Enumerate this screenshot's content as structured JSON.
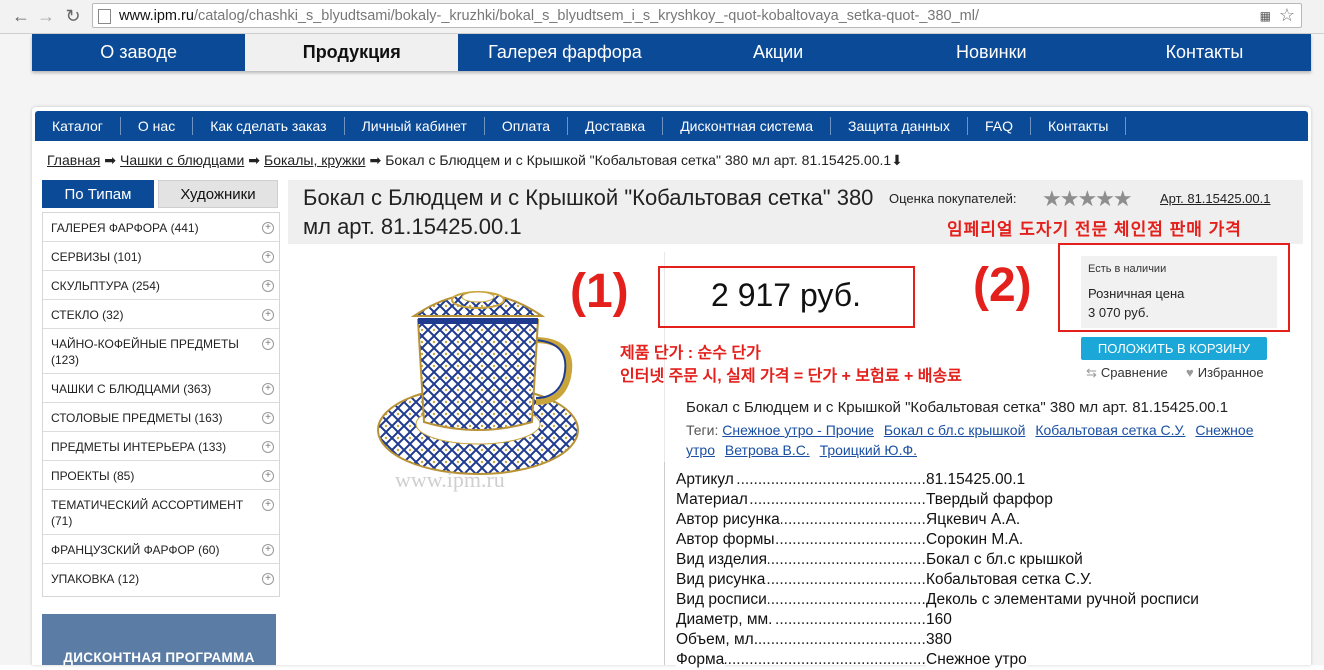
{
  "browser": {
    "url_host": "www.ipm.ru",
    "url_path": "/catalog/chashki_s_blyudtsami/bokaly-_kruzhki/bokal_s_blyudtsem_i_s_kryshkoy_-quot-kobaltovaya_setka-quot-_380_ml/"
  },
  "topnav": [
    "О заводе",
    "Продукция",
    "Галерея фарфора",
    "Акции",
    "Новинки",
    "Контакты"
  ],
  "subnav": [
    "Каталог",
    "О нас",
    "Как сделать заказ",
    "Личный кабинет",
    "Оплата",
    "Доставка",
    "Дисконтная система",
    "Защита данных",
    "FAQ",
    "Контакты"
  ],
  "breadcrumb": {
    "home": "Главная",
    "cat1": "Чашки с блюдцами",
    "cat2": "Бокалы, кружки",
    "current": "Бокал с Блюдцем и с Крышкой \"Кобальтовая сетка\" 380 мл арт. 81.15425.00.1⬇",
    "sep": "➡"
  },
  "sidebar": {
    "tab_types": "По Типам",
    "tab_artists": "Художники",
    "categories": [
      "ГАЛЕРЕЯ ФАРФОРА (441)",
      "СЕРВИЗЫ (101)",
      "СКУЛЬПТУРА (254)",
      "СТЕКЛО (32)",
      "ЧАЙНО-КОФЕЙНЫЕ ПРЕДМЕТЫ (123)",
      "ЧАШКИ С БЛЮДЦАМИ (363)",
      "СТОЛОВЫЕ ПРЕДМЕТЫ (163)",
      "ПРЕДМЕТЫ ИНТЕРЬЕРА (133)",
      "ПРОЕКТЫ (85)",
      "ТЕМАТИЧЕСКИЙ АССОРТИМЕНТ (71)",
      "ФРАНЦУЗСКИЙ ФАРФОР (60)",
      "УПАКОВКА (12)"
    ],
    "promo": "ДИСКОНТНАЯ ПРОГРАММА"
  },
  "product": {
    "title": "Бокал с Блюдцем и с Крышкой \"Кобальтовая сетка\" 380 мл арт. 81.15425.00.1",
    "rating_label": "Оценка покупателей:",
    "stars": "★★★★★",
    "article_link": "Арт. 81.15425.00.1",
    "watermark": "www.ipm.ru",
    "price": "2 917 руб.",
    "in_stock": "Есть в наличии",
    "retail_label": "Розничная цена",
    "retail_price": "3 070 руб.",
    "cart_button": "ПОЛОЖИТЬ В КОРЗИНУ",
    "compare": "Сравнение",
    "favorite": "Избранное",
    "name_line": "Бокал с Блюдцем и с Крышкой \"Кобальтовая сетка\" 380 мл арт. 81.15425.00.1",
    "tags_label": "Теги:",
    "tags": [
      "Снежное утро - Прочие",
      "Бокал с бл.с крышкой",
      "Кобальтовая сетка С.У.",
      "Снежное утро",
      "Ветрова В.С.",
      "Троицкий Ю.Ф."
    ],
    "specs": [
      {
        "k": "Артикул",
        "v": "81.15425.00.1"
      },
      {
        "k": "Материал",
        "v": "Твердый фарфор"
      },
      {
        "k": "Автор рисунка",
        "v": "Яцкевич А.А."
      },
      {
        "k": "Автор формы",
        "v": "Сорокин М.А."
      },
      {
        "k": "Вид изделия",
        "v": "Бокал с бл.с крышкой"
      },
      {
        "k": "Вид рисунка",
        "v": "Кобальтовая сетка С.У."
      },
      {
        "k": "Вид росписи",
        "v": "Деколь с элементами ручной росписи"
      },
      {
        "k": "Диаметр, мм.",
        "v": "160"
      },
      {
        "k": "Объем, мл.",
        "v": "380"
      },
      {
        "k": "Форма",
        "v": "Снежное утро"
      }
    ]
  },
  "annotations": {
    "label1": "(1)",
    "label2": "(2)",
    "header_korean": "임페리얼 도자기 전문 체인점 판매 가격",
    "korean_line1": "제품 단가 : 순수 단가",
    "korean_line2": "인터넷 주문 시, 실제 가격 = 단가 + 보험료 + 배송료",
    "accent": "#e3201b"
  },
  "colors": {
    "nav_blue": "#0b4a96",
    "cart_button": "#1ba7d8"
  }
}
